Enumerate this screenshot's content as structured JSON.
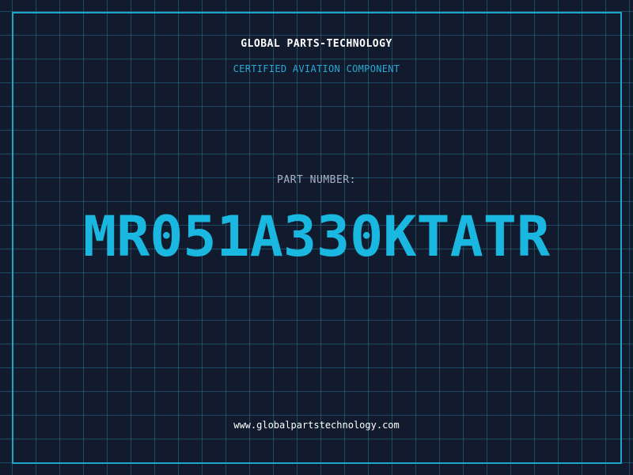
{
  "header": {
    "brand": "GLOBAL PARTS-TECHNOLOGY",
    "subtitle": "CERTIFIED AVIATION COMPONENT"
  },
  "part": {
    "label": "PART NUMBER:",
    "number": "MR051A330KTATR"
  },
  "footer": {
    "website": "www.globalpartstechnology.com"
  },
  "colors": {
    "background": "#121b2e",
    "grid": "#28829f",
    "accent": "#1ab7e0",
    "text": "#ffffff",
    "muted": "#a9b1c2"
  }
}
